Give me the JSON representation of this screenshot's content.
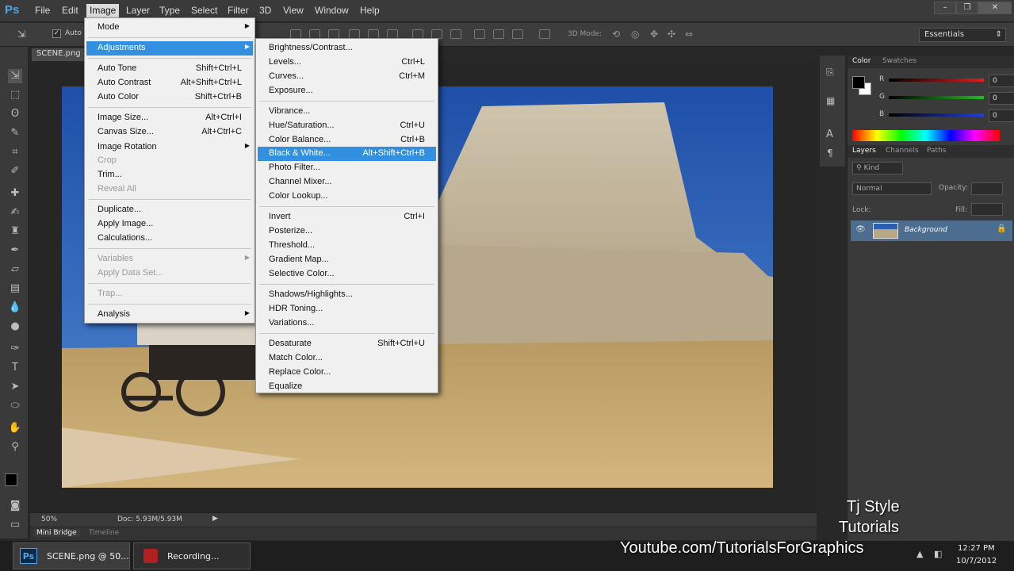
{
  "app": {
    "logo": "Ps"
  },
  "menubar": {
    "items": [
      "File",
      "Edit",
      "Image",
      "Layer",
      "Type",
      "Select",
      "Filter",
      "3D",
      "View",
      "Window",
      "Help"
    ]
  },
  "optionsbar": {
    "auto_label": "Auto",
    "mode_3d": "3D Mode:",
    "workspace": "Essentials"
  },
  "document": {
    "tab": "SCENE.png",
    "zoom": "50%",
    "doc_info": "Doc: 5.93M/5.93M"
  },
  "bottom_tabs": [
    "Mini Bridge",
    "Timeline"
  ],
  "image_menu": {
    "items": [
      {
        "label": "Mode",
        "shortcut": "",
        "submenu": true,
        "disabled": false
      },
      {
        "label": "Adjustments",
        "shortcut": "",
        "submenu": true,
        "disabled": false
      },
      {
        "label": "Auto Tone",
        "shortcut": "Shift+Ctrl+L"
      },
      {
        "label": "Auto Contrast",
        "shortcut": "Alt+Shift+Ctrl+L"
      },
      {
        "label": "Auto Color",
        "shortcut": "Shift+Ctrl+B"
      },
      {
        "label": "Image Size...",
        "shortcut": "Alt+Ctrl+I"
      },
      {
        "label": "Canvas Size...",
        "shortcut": "Alt+Ctrl+C"
      },
      {
        "label": "Image Rotation",
        "shortcut": ""
      },
      {
        "label": "Crop",
        "shortcut": ""
      },
      {
        "label": "Trim...",
        "shortcut": ""
      },
      {
        "label": "Reveal All",
        "shortcut": ""
      },
      {
        "label": "Duplicate...",
        "shortcut": ""
      },
      {
        "label": "Apply Image...",
        "shortcut": ""
      },
      {
        "label": "Calculations...",
        "shortcut": ""
      },
      {
        "label": "Variables",
        "shortcut": ""
      },
      {
        "label": "Apply Data Set...",
        "shortcut": ""
      },
      {
        "label": "Trap...",
        "shortcut": ""
      },
      {
        "label": "Analysis",
        "shortcut": ""
      }
    ]
  },
  "adjustments_menu": {
    "items": [
      {
        "label": "Brightness/Contrast...",
        "shortcut": ""
      },
      {
        "label": "Levels...",
        "shortcut": "Ctrl+L"
      },
      {
        "label": "Curves...",
        "shortcut": "Ctrl+M"
      },
      {
        "label": "Exposure...",
        "shortcut": ""
      },
      {
        "label": "Vibrance...",
        "shortcut": ""
      },
      {
        "label": "Hue/Saturation...",
        "shortcut": "Ctrl+U"
      },
      {
        "label": "Color Balance...",
        "shortcut": "Ctrl+B"
      },
      {
        "label": "Black & White...",
        "shortcut": "Alt+Shift+Ctrl+B"
      },
      {
        "label": "Photo Filter...",
        "shortcut": ""
      },
      {
        "label": "Channel Mixer...",
        "shortcut": ""
      },
      {
        "label": "Color Lookup...",
        "shortcut": ""
      },
      {
        "label": "Invert",
        "shortcut": "Ctrl+I"
      },
      {
        "label": "Posterize...",
        "shortcut": ""
      },
      {
        "label": "Threshold...",
        "shortcut": ""
      },
      {
        "label": "Gradient Map...",
        "shortcut": ""
      },
      {
        "label": "Selective Color...",
        "shortcut": ""
      },
      {
        "label": "Shadows/Highlights...",
        "shortcut": ""
      },
      {
        "label": "HDR Toning...",
        "shortcut": ""
      },
      {
        "label": "Variations...",
        "shortcut": ""
      },
      {
        "label": "Desaturate",
        "shortcut": "Shift+Ctrl+U"
      },
      {
        "label": "Match Color...",
        "shortcut": ""
      },
      {
        "label": "Replace Color...",
        "shortcut": ""
      },
      {
        "label": "Equalize",
        "shortcut": ""
      }
    ]
  },
  "color_panel": {
    "tabs": [
      "Color",
      "Swatches"
    ],
    "channels": [
      {
        "label": "R",
        "value": "0",
        "color": "#e02020"
      },
      {
        "label": "G",
        "value": "0",
        "color": "#20c020"
      },
      {
        "label": "B",
        "value": "0",
        "color": "#2040e0"
      }
    ]
  },
  "layers_panel": {
    "tabs": [
      "Layers",
      "Channels",
      "Paths"
    ],
    "kind": "Kind",
    "blend_mode": "Normal",
    "opacity_label": "Opacity:",
    "lock_label": "Lock:",
    "fill_label": "Fill:",
    "layer_name": "Background"
  },
  "taskbar": {
    "tasks": [
      "SCENE.png @ 50...",
      "Recording..."
    ],
    "time": "12:27 PM",
    "date": "10/7/2012"
  },
  "watermark": {
    "line1": "Tj Style",
    "line2": "Tutorials",
    "url": "Youtube.com/TutorialsForGraphics"
  },
  "colors": {
    "accent": "#3390e0",
    "menubar": "#3a3a3a",
    "sky": "#2c5fb0"
  }
}
